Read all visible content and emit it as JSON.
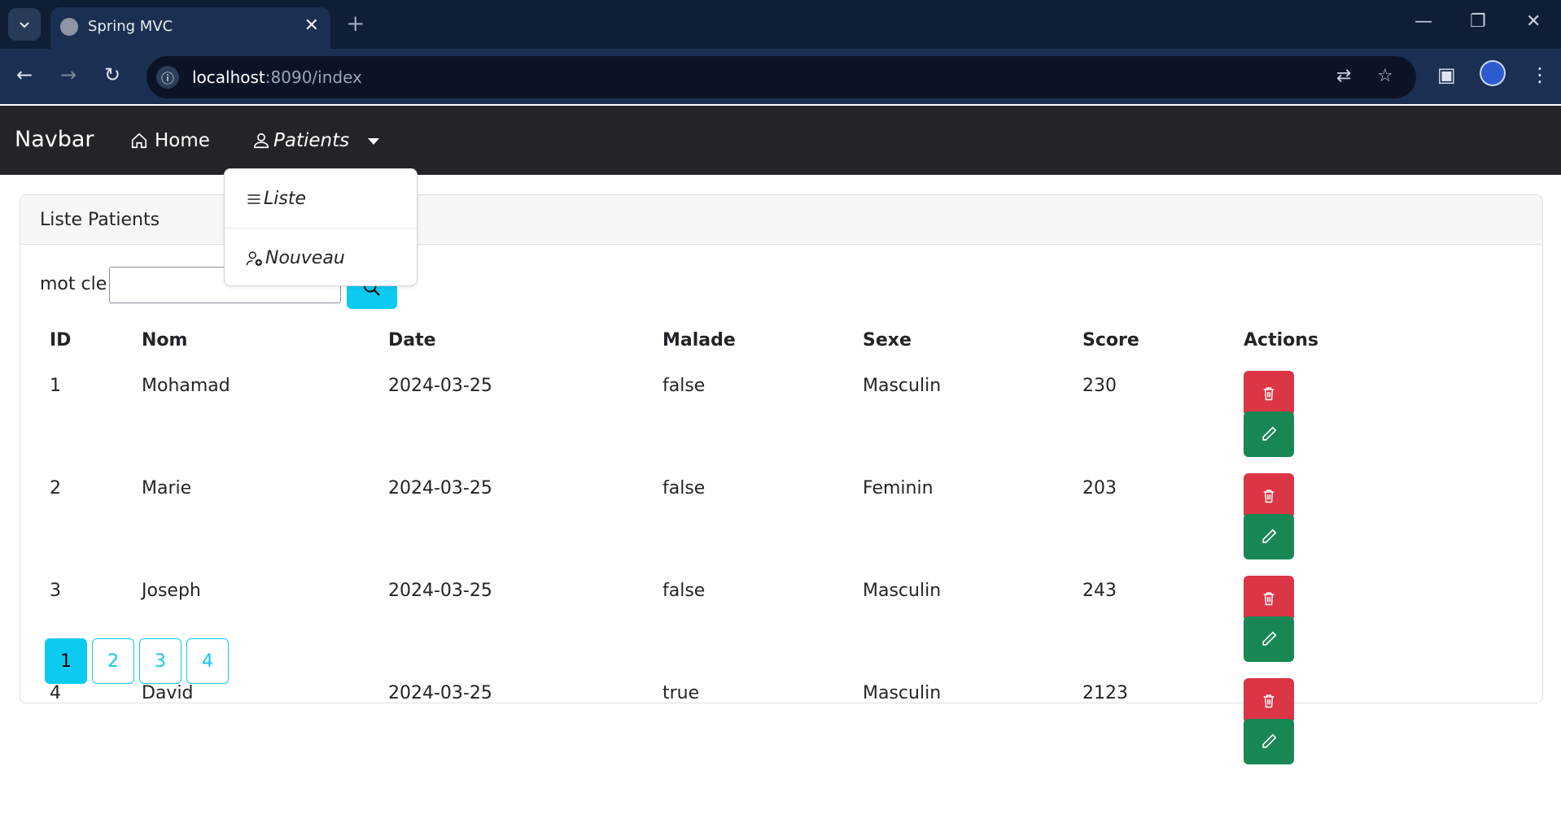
{
  "browser": {
    "tab_title": "Spring MVC",
    "tab_close": "✕",
    "new_tab": "+",
    "url_host": "localhost",
    "url_rest": ":8090/index"
  },
  "navbar": {
    "brand": "Navbar",
    "home_label": "Home",
    "patients_label": "Patients"
  },
  "dropdown": {
    "items": [
      {
        "label": "Liste",
        "icon": "list-icon"
      },
      {
        "label": "Nouveau",
        "icon": "person-plus-icon"
      }
    ]
  },
  "card": {
    "header": "Liste Patients",
    "search_label": "mot cle",
    "search_value": ""
  },
  "table": {
    "columns": [
      "ID",
      "Nom",
      "Date",
      "Malade",
      "Sexe",
      "Score",
      "Actions"
    ],
    "rows": [
      {
        "id": "1",
        "nom": "Mohamad",
        "date": "2024-03-25",
        "malade": "false",
        "sexe": "Masculin",
        "score": "230"
      },
      {
        "id": "2",
        "nom": "Marie",
        "date": "2024-03-25",
        "malade": "false",
        "sexe": "Feminin",
        "score": "203"
      },
      {
        "id": "3",
        "nom": "Joseph",
        "date": "2024-03-25",
        "malade": "false",
        "sexe": "Masculin",
        "score": "243"
      },
      {
        "id": "4",
        "nom": "David",
        "date": "2024-03-25",
        "malade": "true",
        "sexe": "Masculin",
        "score": "2123"
      }
    ]
  },
  "pagination": {
    "pages": [
      "1",
      "2",
      "3",
      "4"
    ],
    "current": "1"
  },
  "colors": {
    "navbar_bg": "#212529",
    "danger": "#dc3545",
    "success": "#198754",
    "info": "#0dcaf0",
    "chrome_bg": "#1b2f52"
  }
}
